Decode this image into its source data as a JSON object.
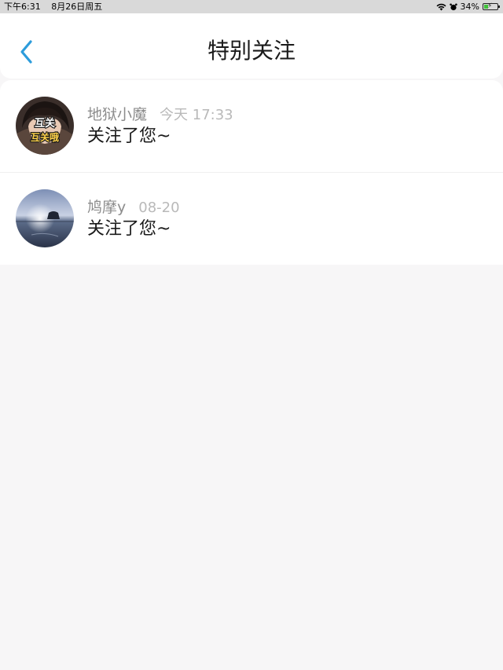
{
  "status_bar": {
    "time": "下午6:31",
    "date": "8月26日周五",
    "battery": "34%",
    "battery_level": 0.34
  },
  "header": {
    "title": "特别关注"
  },
  "notifications": [
    {
      "name": "地狱小魔",
      "time": "今天 17:33",
      "message": "关注了您~",
      "avatar_text": [
        "互关",
        "互关哦"
      ]
    },
    {
      "name": "鸠摩y",
      "time": "08-20",
      "message": "关注了您~"
    }
  ],
  "colors": {
    "accent": "#2d9cdb",
    "background": "#f7f6f7",
    "status_bar": "#d9d9d9"
  }
}
